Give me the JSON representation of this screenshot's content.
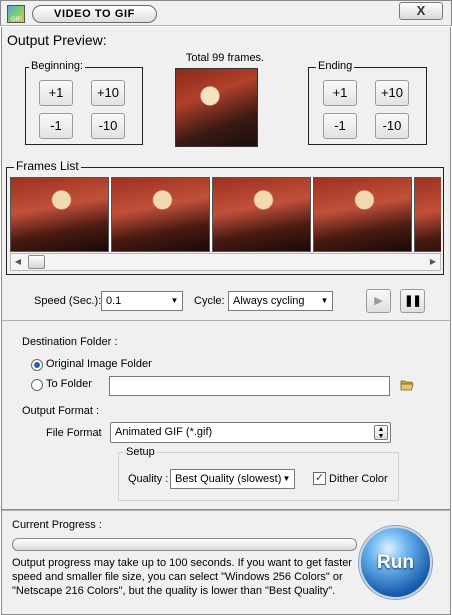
{
  "title_bar": {
    "icon_text": "GIF",
    "title": "VIDEO TO GIF",
    "close_label": "X"
  },
  "preview": {
    "section_title": "Output Preview:",
    "total_frames": "Total 99 frames.",
    "beginning": {
      "label": "Beginning:",
      "buttons": [
        "+1",
        "+10",
        "-1",
        "-10"
      ]
    },
    "ending": {
      "label": "Ending",
      "buttons": [
        "+1",
        "+10",
        "-1",
        "-10"
      ]
    }
  },
  "frames_list": {
    "label": "Frames List",
    "frame_count_visible": 5
  },
  "playback": {
    "speed_label": "Speed (Sec.):",
    "speed_value": "0.1",
    "cycle_label": "Cycle:",
    "cycle_value": "Always cycling",
    "play_icon": "play-icon",
    "pause_icon": "pause-icon"
  },
  "destination": {
    "label": "Destination Folder :",
    "option_original": "Original Image Folder",
    "option_to_folder": "To Folder",
    "folder_path": "",
    "selected": "Original Image Folder"
  },
  "output_format": {
    "label": "Output Format :",
    "file_format_label": "File Format",
    "file_format_value": "Animated GIF (*.gif)",
    "setup_label": "Setup",
    "quality_label": "Quality :",
    "quality_value": "Best Quality (slowest)",
    "dither_label": "Dither Color",
    "dither_checked": true
  },
  "progress": {
    "label": "Current Progress :",
    "value": 0,
    "info": "Output progress may take up to 100 seconds. If you want to get faster speed and smaller file size, you can select \"Windows 256 Colors\" or \"Netscape 216 Colors\", but the quality is lower than \"Best Quality\"."
  },
  "run_button": "Run",
  "colors": {
    "panel_bg": "#f0f0f0",
    "run_blue": "#1a5fb0",
    "radio_dot": "#2c5ea8"
  }
}
